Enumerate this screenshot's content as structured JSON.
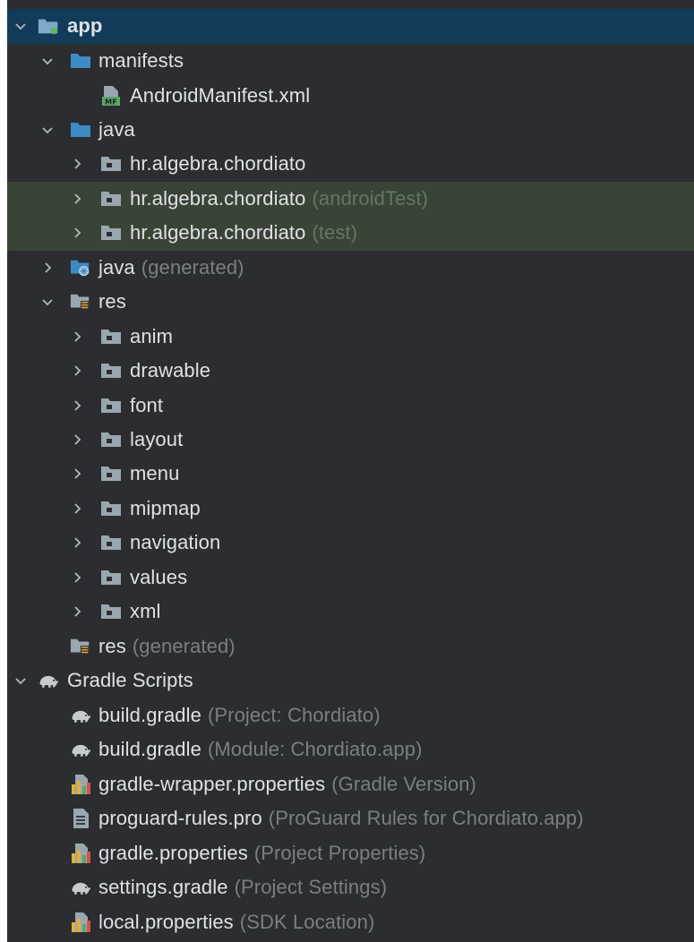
{
  "colors": {
    "background": "#2b2d30",
    "selected_row": "#123b5a",
    "highlight_row": "#3a4436",
    "text": "#dfe1e5",
    "hint": "#7a7e85",
    "folder_blue": "#3e8ac4",
    "package_gray": "#9aa7b0"
  },
  "tree": [
    {
      "name": "app",
      "hint": "",
      "icon": "module-folder-icon",
      "arrow": "expanded",
      "state": "selected",
      "bold": true
    },
    {
      "name": "manifests",
      "hint": "",
      "icon": "folder-blue-icon",
      "arrow": "expanded",
      "state": ""
    },
    {
      "name": "AndroidManifest.xml",
      "hint": "",
      "icon": "manifest-file-icon",
      "arrow": "none",
      "state": ""
    },
    {
      "name": "java",
      "hint": "",
      "icon": "folder-blue-icon",
      "arrow": "expanded",
      "state": ""
    },
    {
      "name": "hr.algebra.chordiato",
      "hint": "",
      "icon": "package-icon",
      "arrow": "collapsed",
      "state": ""
    },
    {
      "name": "hr.algebra.chordiato",
      "hint": "(androidTest)",
      "icon": "package-icon",
      "arrow": "collapsed",
      "state": "highlight"
    },
    {
      "name": "hr.algebra.chordiato",
      "hint": "(test)",
      "icon": "package-icon",
      "arrow": "collapsed",
      "state": "highlight"
    },
    {
      "name": "java",
      "hint": "(generated)",
      "icon": "generated-folder-icon",
      "arrow": "collapsed",
      "state": ""
    },
    {
      "name": "res",
      "hint": "",
      "icon": "resource-folder-icon",
      "arrow": "expanded",
      "state": ""
    },
    {
      "name": "anim",
      "hint": "",
      "icon": "package-icon",
      "arrow": "collapsed",
      "state": ""
    },
    {
      "name": "drawable",
      "hint": "",
      "icon": "package-icon",
      "arrow": "collapsed",
      "state": ""
    },
    {
      "name": "font",
      "hint": "",
      "icon": "package-icon",
      "arrow": "collapsed",
      "state": ""
    },
    {
      "name": "layout",
      "hint": "",
      "icon": "package-icon",
      "arrow": "collapsed",
      "state": ""
    },
    {
      "name": "menu",
      "hint": "",
      "icon": "package-icon",
      "arrow": "collapsed",
      "state": ""
    },
    {
      "name": "mipmap",
      "hint": "",
      "icon": "package-icon",
      "arrow": "collapsed",
      "state": ""
    },
    {
      "name": "navigation",
      "hint": "",
      "icon": "package-icon",
      "arrow": "collapsed",
      "state": ""
    },
    {
      "name": "values",
      "hint": "",
      "icon": "package-icon",
      "arrow": "collapsed",
      "state": ""
    },
    {
      "name": "xml",
      "hint": "",
      "icon": "package-icon",
      "arrow": "collapsed",
      "state": ""
    },
    {
      "name": "res",
      "hint": "(generated)",
      "icon": "resource-folder-icon",
      "arrow": "none",
      "state": ""
    },
    {
      "name": "Gradle Scripts",
      "hint": "",
      "icon": "gradle-elephant-icon",
      "arrow": "expanded",
      "state": ""
    },
    {
      "name": "build.gradle",
      "hint": "(Project: Chordiato)",
      "icon": "gradle-elephant-icon",
      "arrow": "none",
      "state": ""
    },
    {
      "name": "build.gradle",
      "hint": "(Module: Chordiato.app)",
      "icon": "gradle-elephant-icon",
      "arrow": "none",
      "state": ""
    },
    {
      "name": "gradle-wrapper.properties",
      "hint": "(Gradle Version)",
      "icon": "properties-file-icon",
      "arrow": "none",
      "state": ""
    },
    {
      "name": "proguard-rules.pro",
      "hint": "(ProGuard Rules for Chordiato.app)",
      "icon": "text-file-icon",
      "arrow": "none",
      "state": ""
    },
    {
      "name": "gradle.properties",
      "hint": "(Project Properties)",
      "icon": "properties-file-icon",
      "arrow": "none",
      "state": ""
    },
    {
      "name": "settings.gradle",
      "hint": "(Project Settings)",
      "icon": "gradle-elephant-icon",
      "arrow": "none",
      "state": ""
    },
    {
      "name": "local.properties",
      "hint": "(SDK Location)",
      "icon": "properties-file-icon",
      "arrow": "none",
      "state": ""
    }
  ]
}
